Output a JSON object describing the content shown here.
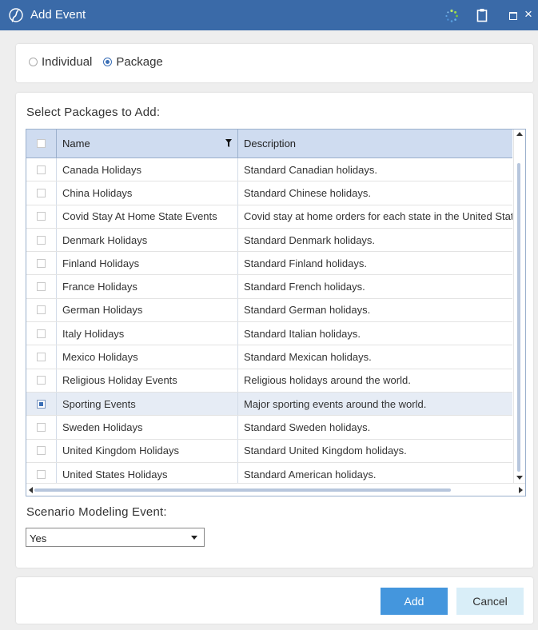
{
  "window": {
    "title": "Add Event",
    "icons": [
      "app-logo-icon",
      "spinner-icon",
      "clipboard-icon",
      "maximize-icon",
      "close-icon"
    ],
    "close_glyph": "×"
  },
  "mode": {
    "options": [
      {
        "label": "Individual",
        "selected": false
      },
      {
        "label": "Package",
        "selected": true
      }
    ]
  },
  "packages": {
    "label": "Select Packages to Add:",
    "columns": {
      "name": "Name",
      "description": "Description"
    },
    "rows": [
      {
        "name": "Canada Holidays",
        "description": "Standard Canadian holidays.",
        "checked": false
      },
      {
        "name": "China Holidays",
        "description": "Standard Chinese holidays.",
        "checked": false
      },
      {
        "name": "Covid Stay At Home State Events",
        "description": "Covid stay at home orders for each state in the United States.",
        "checked": false
      },
      {
        "name": "Denmark Holidays",
        "description": "Standard Denmark holidays.",
        "checked": false
      },
      {
        "name": "Finland Holidays",
        "description": "Standard Finland holidays.",
        "checked": false
      },
      {
        "name": "France Holidays",
        "description": "Standard French holidays.",
        "checked": false
      },
      {
        "name": "German Holidays",
        "description": "Standard German holidays.",
        "checked": false
      },
      {
        "name": "Italy Holidays",
        "description": "Standard Italian holidays.",
        "checked": false
      },
      {
        "name": "Mexico Holidays",
        "description": "Standard Mexican holidays.",
        "checked": false
      },
      {
        "name": "Religious Holiday Events",
        "description": "Religious holidays around the world.",
        "checked": false
      },
      {
        "name": "Sporting Events",
        "description": "Major sporting events around the world.",
        "checked": true
      },
      {
        "name": "Sweden Holidays",
        "description": "Standard Sweden holidays.",
        "checked": false
      },
      {
        "name": "United Kingdom Holidays",
        "description": "Standard United Kingdom holidays.",
        "checked": false
      },
      {
        "name": "United States Holidays",
        "description": "Standard American holidays.",
        "checked": false
      }
    ]
  },
  "scenario": {
    "label": "Scenario Modeling Event:",
    "value": "Yes"
  },
  "footer": {
    "add_label": "Add",
    "cancel_label": "Cancel"
  },
  "colors": {
    "titlebar": "#3a6aa8",
    "grid_header": "#cfdcf0",
    "selected_row": "#e6ecf5",
    "add_button": "#4496dd",
    "cancel_button": "#d9eef8"
  }
}
